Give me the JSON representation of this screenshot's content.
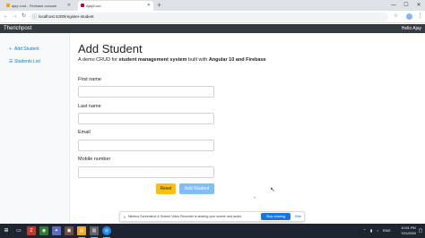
{
  "browser": {
    "tabs": [
      {
        "title": "ajay crud - Firebase console",
        "favicon_color": "#ffa000",
        "active": false
      },
      {
        "title": "AjayCrud",
        "favicon_color": "#c3002f",
        "active": true
      }
    ],
    "new_tab_icon": "plus-icon",
    "url": "localhost:4200/register-student",
    "window_controls": {
      "minimize": "—",
      "maximize": "☐",
      "close": "✕"
    }
  },
  "app": {
    "brand": "Therichpost",
    "greeting": "Hello Ajay"
  },
  "sidebar": {
    "items": [
      {
        "label": "Add Student",
        "icon": "user-plus-icon"
      },
      {
        "label": "Students List",
        "icon": "list-icon"
      }
    ]
  },
  "main": {
    "title": "Add Student",
    "subtitle_prefix": "A demo CRUD for ",
    "subtitle_bold1": "student management system",
    "subtitle_mid": " built with ",
    "subtitle_bold2": "Angular 10 and Firebase",
    "fields": [
      {
        "label": "First name",
        "value": "",
        "placeholder": ""
      },
      {
        "label": "Last name",
        "value": "",
        "placeholder": ""
      },
      {
        "label": "Email",
        "value": "",
        "placeholder": ""
      },
      {
        "label": "Mobile number",
        "value": "",
        "placeholder": ""
      }
    ],
    "buttons": {
      "reset": "Reset",
      "add": "Add Student"
    }
  },
  "share_banner": {
    "message": "Nimbus Screenshot & Screen Video Recorder is sharing your screen and audio.",
    "stop": "Stop sharing",
    "hide": "Hide"
  },
  "taskbar": {
    "time": "10:01 PM",
    "date": "7/21/2020",
    "tray_lang": "ENG"
  },
  "colors": {
    "navbar": "#343a40",
    "link": "#007bff",
    "reset": "#ffc107",
    "add": "#80bdff",
    "stop": "#1a73e8"
  }
}
